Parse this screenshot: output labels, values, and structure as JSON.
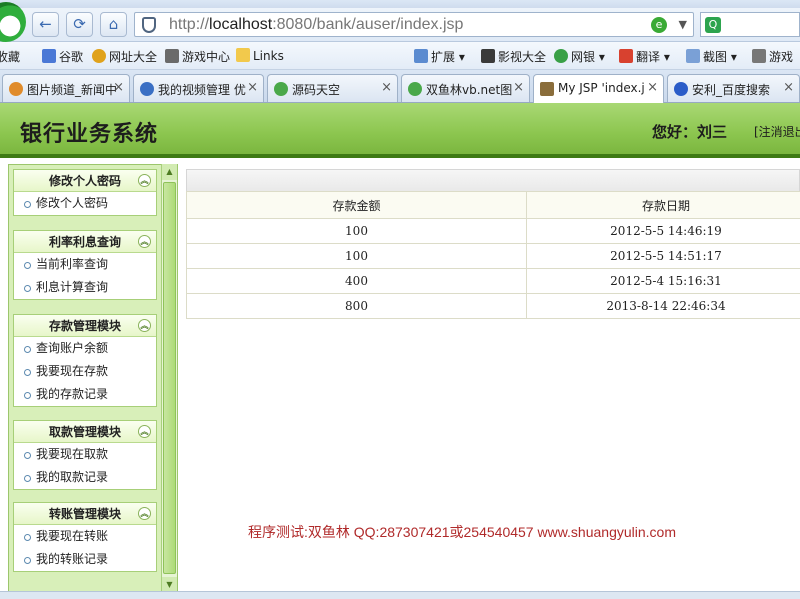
{
  "browser": {
    "address_url": "http://localhost:8080/bank/auser/index.jsp",
    "url_host": "localhost",
    "url_prefix": "http://",
    "url_rest": ":8080/bank/auser/index.jsp",
    "favorites": [
      "收藏",
      "谷歌",
      "网址大全",
      "游戏中心",
      "Links",
      "扩展",
      "影视大全",
      "网银",
      "翻译",
      "截图",
      "游戏"
    ],
    "tabs": [
      {
        "label": "图片频道_新闻中"
      },
      {
        "label": "我的视频管理 优"
      },
      {
        "label": "源码天空"
      },
      {
        "label": "双鱼林vb.net图"
      },
      {
        "label": "My JSP 'index.j"
      },
      {
        "label": "安利_百度搜索"
      }
    ]
  },
  "header": {
    "title": "银行业务系统",
    "greeting": "您好：刘三",
    "logout": "[注消退出]"
  },
  "menus": [
    {
      "title": "修改个人密码",
      "items": [
        "修改个人密码"
      ]
    },
    {
      "title": "利率利息查询",
      "items": [
        "当前利率查询",
        "利息计算查询"
      ]
    },
    {
      "title": "存款管理模块",
      "items": [
        "查询账户余额",
        "我要现在存款",
        "我的存款记录"
      ]
    },
    {
      "title": "取款管理模块",
      "items": [
        "我要现在取款",
        "我的取款记录"
      ]
    },
    {
      "title": "转账管理模块",
      "items": [
        "我要现在转账",
        "我的转账记录"
      ]
    }
  ],
  "table": {
    "headers": [
      "存款金额",
      "存款日期"
    ],
    "rows": [
      [
        "100",
        "2012-5-5 14:46:19"
      ],
      [
        "100",
        "2012-5-5 14:51:17"
      ],
      [
        "400",
        "2012-5-4 15:16:31"
      ],
      [
        "800",
        "2013-8-14 22:46:34"
      ]
    ]
  },
  "footer": {
    "text": "程序测试:双鱼林 QQ:287307421或254540457 www.shuangyulin.com"
  }
}
